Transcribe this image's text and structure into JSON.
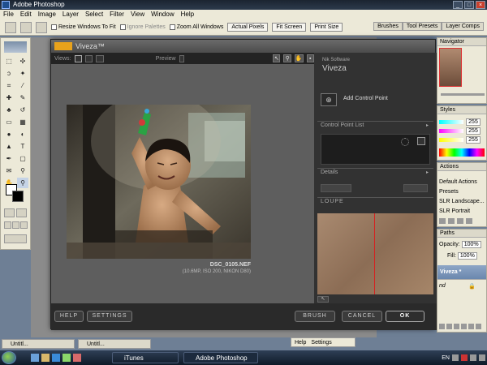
{
  "app": {
    "title": "Adobe Photoshop"
  },
  "menu": [
    "File",
    "Edit",
    "Image",
    "Layer",
    "Select",
    "Filter",
    "View",
    "Window",
    "Help"
  ],
  "options": {
    "resize_label": "Resize Windows To Fit",
    "ignore_label": "Ignore Palettes",
    "zoom_all_label": "Zoom All Windows",
    "actual_pixels": "Actual Pixels",
    "fit_screen": "Fit Screen",
    "print_size": "Print Size"
  },
  "top_tabs": [
    "Brushes",
    "Tool Presets",
    "Layer Comps"
  ],
  "viveza": {
    "title": "Viveza™",
    "views_label": "Views:",
    "preview_label": "Preview",
    "brand_small": "Nik Software",
    "brand_name": "Viveza",
    "add_control_point": "Add Control Point",
    "control_point_list": "Control Point List",
    "details": "Details",
    "loupe": "LOUPE",
    "file_name": "DSC_0105.NEF",
    "file_info": "(10.6MP, ISO 200, NIKON D80)",
    "btn_help": "HELP",
    "btn_settings": "SETTINGS",
    "btn_brush": "BRUSH",
    "btn_cancel": "CANCEL",
    "btn_ok": "OK"
  },
  "right_panels": {
    "navigator_tab": "Navigator",
    "styles_tab": "Styles",
    "values": [
      "255",
      "255",
      "255"
    ],
    "actions_tab": "Actions",
    "actions": [
      "Default Actions",
      "Presets",
      "SLR Landscape...",
      "SLR Portrait"
    ],
    "layers_tab": "Paths",
    "opacity_label": "Opacity:",
    "opacity_value": "100%",
    "fill_label": "Fill:",
    "fill_value": "100%",
    "layer_name": "Viveza *",
    "background_layer": "nd"
  },
  "bottom_docs": [
    "Untitl...",
    "Untitl..."
  ],
  "help_bar": {
    "help": "Help",
    "settings": "Settings"
  },
  "taskbar": {
    "itunes": "iTunes",
    "photoshop": "Adobe Photoshop",
    "lang": "EN"
  },
  "colors": {
    "accent": "#e8a21b",
    "loupe_line": "#d62020",
    "ok_border": "#aaaaaa"
  }
}
